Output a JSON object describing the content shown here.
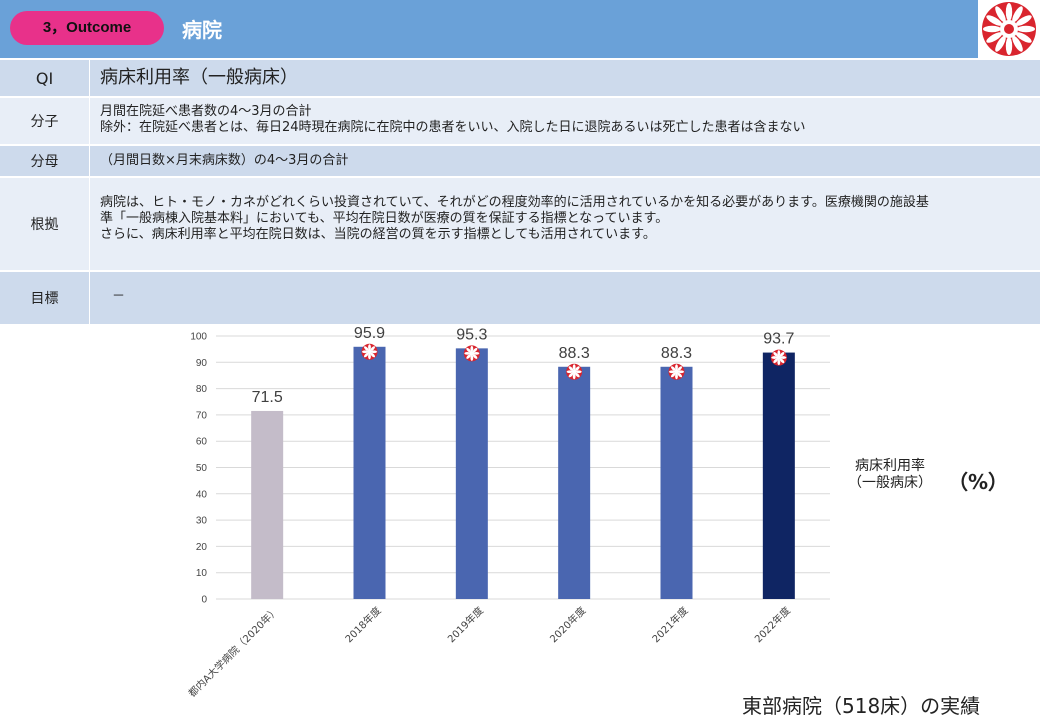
{
  "header": {
    "badge": "3，Outcome",
    "title": "病院"
  },
  "table": {
    "qi": {
      "label": "QI",
      "value": "病床利用率（一般病床）"
    },
    "numerator": {
      "label": "分子",
      "lines": [
        "月間在院延べ患者数の4～3月の合計",
        "除外：在院延べ患者とは、毎日24時現在病院に在院中の患者をいい、入院した日に退院あるいは死亡した患者は含まない"
      ]
    },
    "denominator": {
      "label": "分母",
      "value": "（月間日数×月末病床数）の4～3月の合計"
    },
    "basis": {
      "label": "根拠",
      "lines": [
        "病院は、ヒト・モノ・カネがどれくらい投資されていて、それがどの程度効率的に活用されているかを知る必要があります。医療機関の施設基",
        "準「一般病棟入院基本料」においても、平均在院日数が医療の質を保証する指標となっています。",
        "さらに、病床利用率と平均在院日数は、当院の経営の質を示す指標としても活用されています。"
      ]
    },
    "target": {
      "label": "目標",
      "value": "－"
    }
  },
  "chart_data": {
    "type": "bar",
    "categories": [
      "都内A大学病院（2020年）",
      "2018年度",
      "2019年度",
      "2020年度",
      "2021年度",
      "2022年度"
    ],
    "values": [
      71.5,
      95.9,
      95.3,
      88.3,
      88.3,
      93.7
    ],
    "value_labels": [
      "71.5",
      "95.9",
      "95.3",
      "88.3",
      "88.3",
      "93.7"
    ],
    "ylim": [
      0,
      100
    ],
    "yticks": [
      0,
      10,
      20,
      30,
      40,
      50,
      60,
      70,
      80,
      90,
      100
    ],
    "grid": true,
    "colors": [
      "#c4bcc9",
      "#4a66b0",
      "#4a66b0",
      "#4a66b0",
      "#4a66b0",
      "#0f2563"
    ],
    "marker_on_own_hospital_bars": true,
    "series_label_lines": [
      "病床利用率",
      "（一般病床）"
    ],
    "unit": "（%）"
  },
  "footer": {
    "note": "東部病院（518床）の実績"
  }
}
